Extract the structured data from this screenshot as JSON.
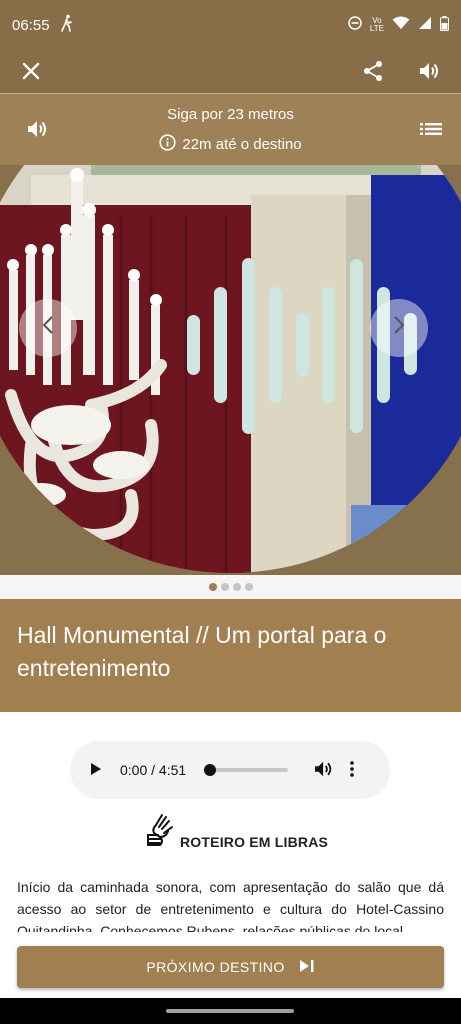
{
  "status_bar": {
    "time": "06:55",
    "network_label_1": "Vo",
    "network_label_2": "LTE"
  },
  "toolbar": {
    "close_icon": "close-icon",
    "share_icon": "share-icon",
    "volume_icon": "volume-icon"
  },
  "navigation": {
    "instruction": "Siga por 23 metros",
    "distance_info": "22m até o destino"
  },
  "carousel": {
    "slide_count": 4,
    "active_index": 0
  },
  "point": {
    "title": "Hall Monumental // Um portal para o entretenimento",
    "description": "Início da caminhada sonora, com apresentação do salão que dá acesso ao setor de entretenimento e cultura do Hotel-Cassino Quitandinha. Conhecemos Rubens, relações públicas do local"
  },
  "audio_player": {
    "time_display": "0:00 / 4:51",
    "progress": 0
  },
  "libras": {
    "label": "ROTEIRO EM LIBRAS"
  },
  "next_button": {
    "label": "PRÓXIMO DESTINO"
  },
  "colors": {
    "brand_dark": "#876e49",
    "brand": "#a17f50",
    "waveform": "#cfe6e0"
  }
}
